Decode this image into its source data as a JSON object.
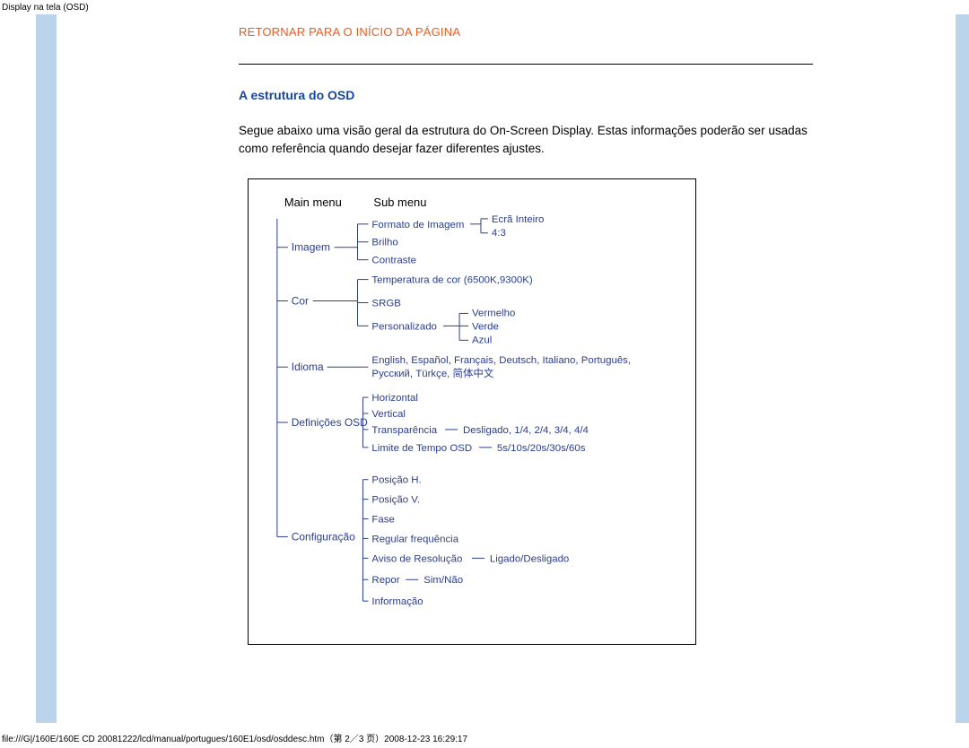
{
  "page_title_small": "Display na tela (OSD)",
  "top_link": "RETORNAR PARA O INÍCIO DA PÁGINA",
  "section_heading": "A estrutura do OSD",
  "body_para": "Segue abaixo uma visão geral da estrutura do On-Screen Display. Estas informações poderão ser usadas como referência quando desejar fazer diferentes ajustes.",
  "footer": "file:///G|/160E/160E CD 20081222/lcd/manual/portugues/160E1/osd/osddesc.htm（第 2／3 页）2008-12-23 16:29:17",
  "tree": {
    "col_main": "Main menu",
    "col_sub": "Sub menu",
    "imagem": {
      "label": "Imagem",
      "sub1": "Formato de Imagem",
      "sub1_opt1": "Ecrã Inteiro",
      "sub1_opt2": "4:3",
      "sub2": "Brilho",
      "sub3": "Contraste"
    },
    "cor": {
      "label": "Cor",
      "sub1": "Temperatura de cor (6500K,9300K)",
      "sub2": "SRGB",
      "sub3": "Personalizado",
      "sub3_opt1": "Vermelho",
      "sub3_opt2": "Verde",
      "sub3_opt3": "Azul"
    },
    "idioma": {
      "label": "Idioma",
      "line1": "English, Español, Français, Deutsch, Italiano, Português,",
      "line2": "Русский, Türkçe, 简体中文"
    },
    "osd": {
      "label": "Definições OSD",
      "sub1": "Horizontal",
      "sub2": "Vertical",
      "sub3": "Transparência",
      "sub3_opts": "Desligado, 1/4, 2/4, 3/4, 4/4",
      "sub4": "Limite de Tempo OSD",
      "sub4_opts": "5s/10s/20s/30s/60s"
    },
    "config": {
      "label": "Configuração",
      "sub1": "Posição H.",
      "sub2": "Posição V.",
      "sub3": "Fase",
      "sub4": "Regular frequência",
      "sub5": "Aviso de Resolução",
      "sub5_opts": "Ligado/Desligado",
      "sub6": "Repor",
      "sub6_opts": "Sim/Não",
      "sub7": "Informação"
    }
  }
}
